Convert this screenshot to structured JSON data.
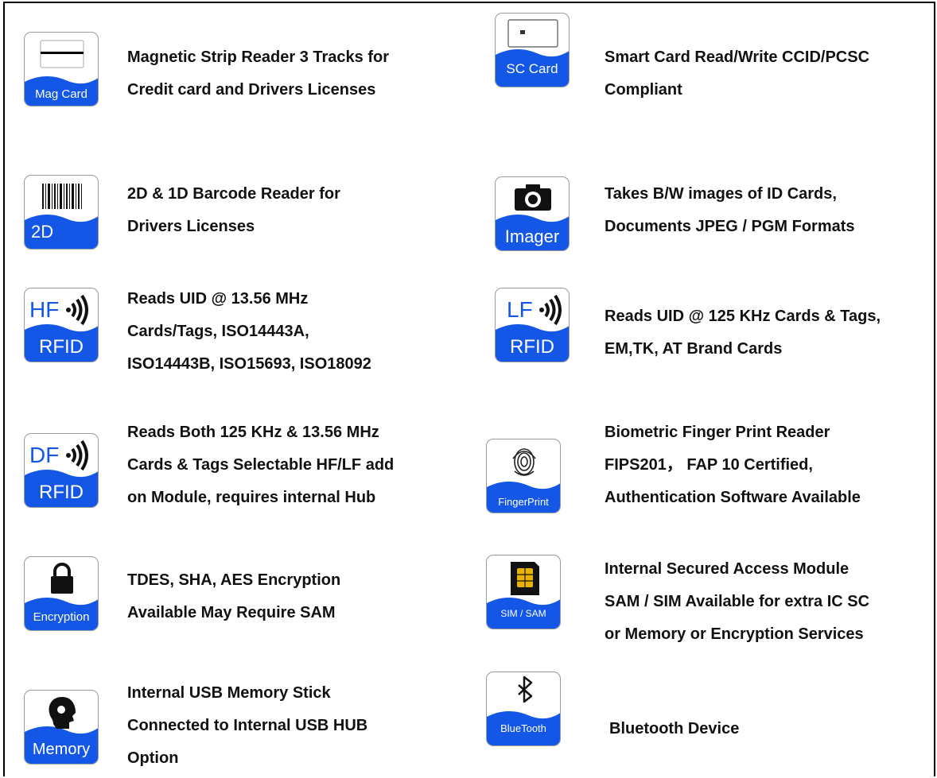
{
  "features": [
    {
      "id": "mag",
      "icon_label": "Mag Card",
      "lines": [
        "Magnetic Strip Reader 3 Tracks for",
        "Credit card and Drivers Licenses"
      ]
    },
    {
      "id": "sc",
      "icon_label": "SC Card",
      "lines": [
        "Smart Card Read/Write CCID/PCSC",
        "Compliant"
      ]
    },
    {
      "id": "bc",
      "icon_label": "2D",
      "lines": [
        "2D & 1D Barcode Reader for",
        "Drivers Licenses"
      ]
    },
    {
      "id": "img",
      "icon_label": "Imager",
      "lines": [
        "Takes B/W images of ID Cards,",
        "Documents JPEG / PGM Formats"
      ]
    },
    {
      "id": "hf",
      "icon_label": "RFID",
      "icon_top": "HF",
      "lines": [
        "Reads UID @ 13.56 MHz",
        "Cards/Tags, ISO14443A,",
        "ISO14443B, ISO15693, ISO18092"
      ]
    },
    {
      "id": "lf",
      "icon_label": "RFID",
      "icon_top": "LF",
      "lines": [
        "Reads UID @ 125 KHz Cards & Tags,",
        "EM,TK, AT Brand Cards"
      ]
    },
    {
      "id": "df",
      "icon_label": "RFID",
      "icon_top": "DF",
      "lines": [
        "Reads Both 125 KHz & 13.56 MHz",
        "Cards & Tags Selectable HF/LF add",
        "on Module, requires internal Hub"
      ]
    },
    {
      "id": "fp",
      "icon_label": "FingerPrint",
      "lines": [
        "Biometric Finger Print Reader",
        "FIPS201，  FAP 10 Certified,",
        "Authentication Software Available"
      ]
    },
    {
      "id": "enc",
      "icon_label": "Encryption",
      "lines": [
        "TDES, SHA, AES Encryption",
        "Available May Require SAM"
      ]
    },
    {
      "id": "sam",
      "icon_label": "SIM / SAM",
      "lines": [
        "Internal Secured Access Module",
        "SAM / SIM Available for extra IC SC",
        "or Memory or Encryption Services"
      ]
    },
    {
      "id": "mem",
      "icon_label": "Memory",
      "lines": [
        "Internal USB Memory Stick",
        "Connected to Internal USB HUB",
        "Option"
      ]
    },
    {
      "id": "bt",
      "icon_label": "BlueTooth",
      "lines": [
        "Bluetooth Device"
      ]
    }
  ],
  "colors": {
    "brand_blue": "#1457e6",
    "text": "#111111",
    "icon_border": "#9a9a9a"
  }
}
